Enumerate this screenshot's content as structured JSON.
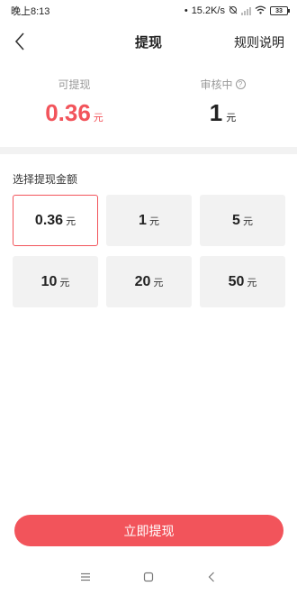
{
  "status_bar": {
    "time": "晚上8:13",
    "net_speed": "15.2K/s",
    "battery": "33"
  },
  "nav": {
    "title": "提现",
    "rules_label": "规则说明"
  },
  "balance": {
    "withdrawable_label": "可提现",
    "withdrawable_amount": "0.36",
    "withdrawable_unit": "元",
    "reviewing_label": "审核中",
    "reviewing_amount": "1",
    "reviewing_unit": "元"
  },
  "amount_section": {
    "label": "选择提现金额",
    "options": [
      {
        "amount": "0.36",
        "unit": "元",
        "selected": true
      },
      {
        "amount": "1",
        "unit": "元",
        "selected": false
      },
      {
        "amount": "5",
        "unit": "元",
        "selected": false
      },
      {
        "amount": "10",
        "unit": "元",
        "selected": false
      },
      {
        "amount": "20",
        "unit": "元",
        "selected": false
      },
      {
        "amount": "50",
        "unit": "元",
        "selected": false
      }
    ]
  },
  "withdraw_button": {
    "label": "立即提现"
  },
  "colors": {
    "accent": "#f2545b",
    "option_bg": "#f2f2f2"
  },
  "icons": [
    "back-icon",
    "help-icon",
    "menu-icon",
    "home-icon",
    "nav-back-icon",
    "signal-icon",
    "wifi-icon",
    "battery-icon"
  ]
}
